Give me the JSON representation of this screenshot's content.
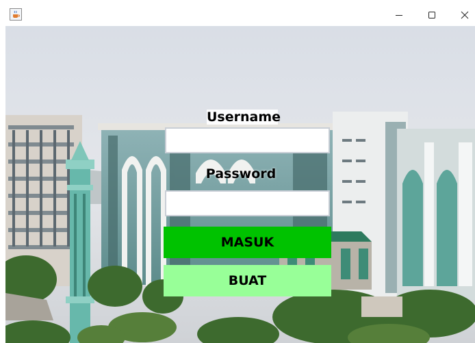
{
  "window": {
    "icon": "java-cup-icon",
    "controls": {
      "minimize_icon": "minimize-icon",
      "maximize_icon": "maximize-icon",
      "close_icon": "close-icon"
    }
  },
  "form": {
    "username_label": "Username",
    "username_value": "",
    "password_label": "Password",
    "password_value": ""
  },
  "buttons": {
    "masuk_label": "MASUK",
    "buat_label": "BUAT"
  },
  "colors": {
    "masuk_bg": "#00c200",
    "buat_bg": "#98ff98",
    "field_bg": "#ffffff",
    "field_border": "#c9ced6"
  }
}
